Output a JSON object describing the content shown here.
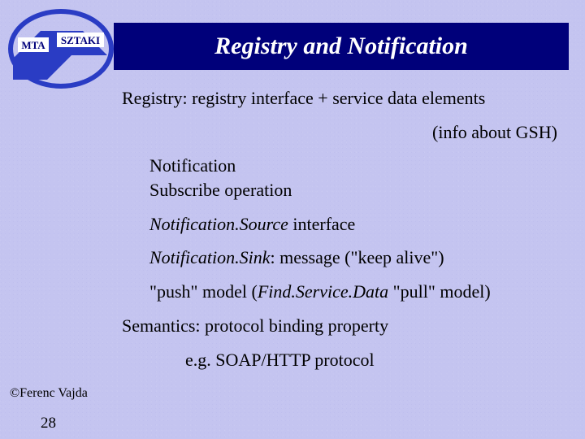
{
  "logo": {
    "label_left": "MTA",
    "label_right": "SZTAKI"
  },
  "title": "Registry and Notification",
  "lines": {
    "l1": "Registry: registry interface + service data elements",
    "l2": "(info about GSH)",
    "l3a": "Notification",
    "l3b": "Subscribe operation",
    "l4_em": "Notification.Source",
    "l4_rest": " interface",
    "l5_em": "Notification.Sink",
    "l5_rest": ":  message (\"keep alive\")",
    "l6_a": "\"push\" model (",
    "l6_em": "Find.Service.Data",
    "l6_b": " \"pull\" model)",
    "l7": "Semantics: protocol binding property",
    "l8": "e.g. SOAP/HTTP protocol"
  },
  "footer": {
    "copyright": "©Ferenc Vajda",
    "page": "28"
  }
}
